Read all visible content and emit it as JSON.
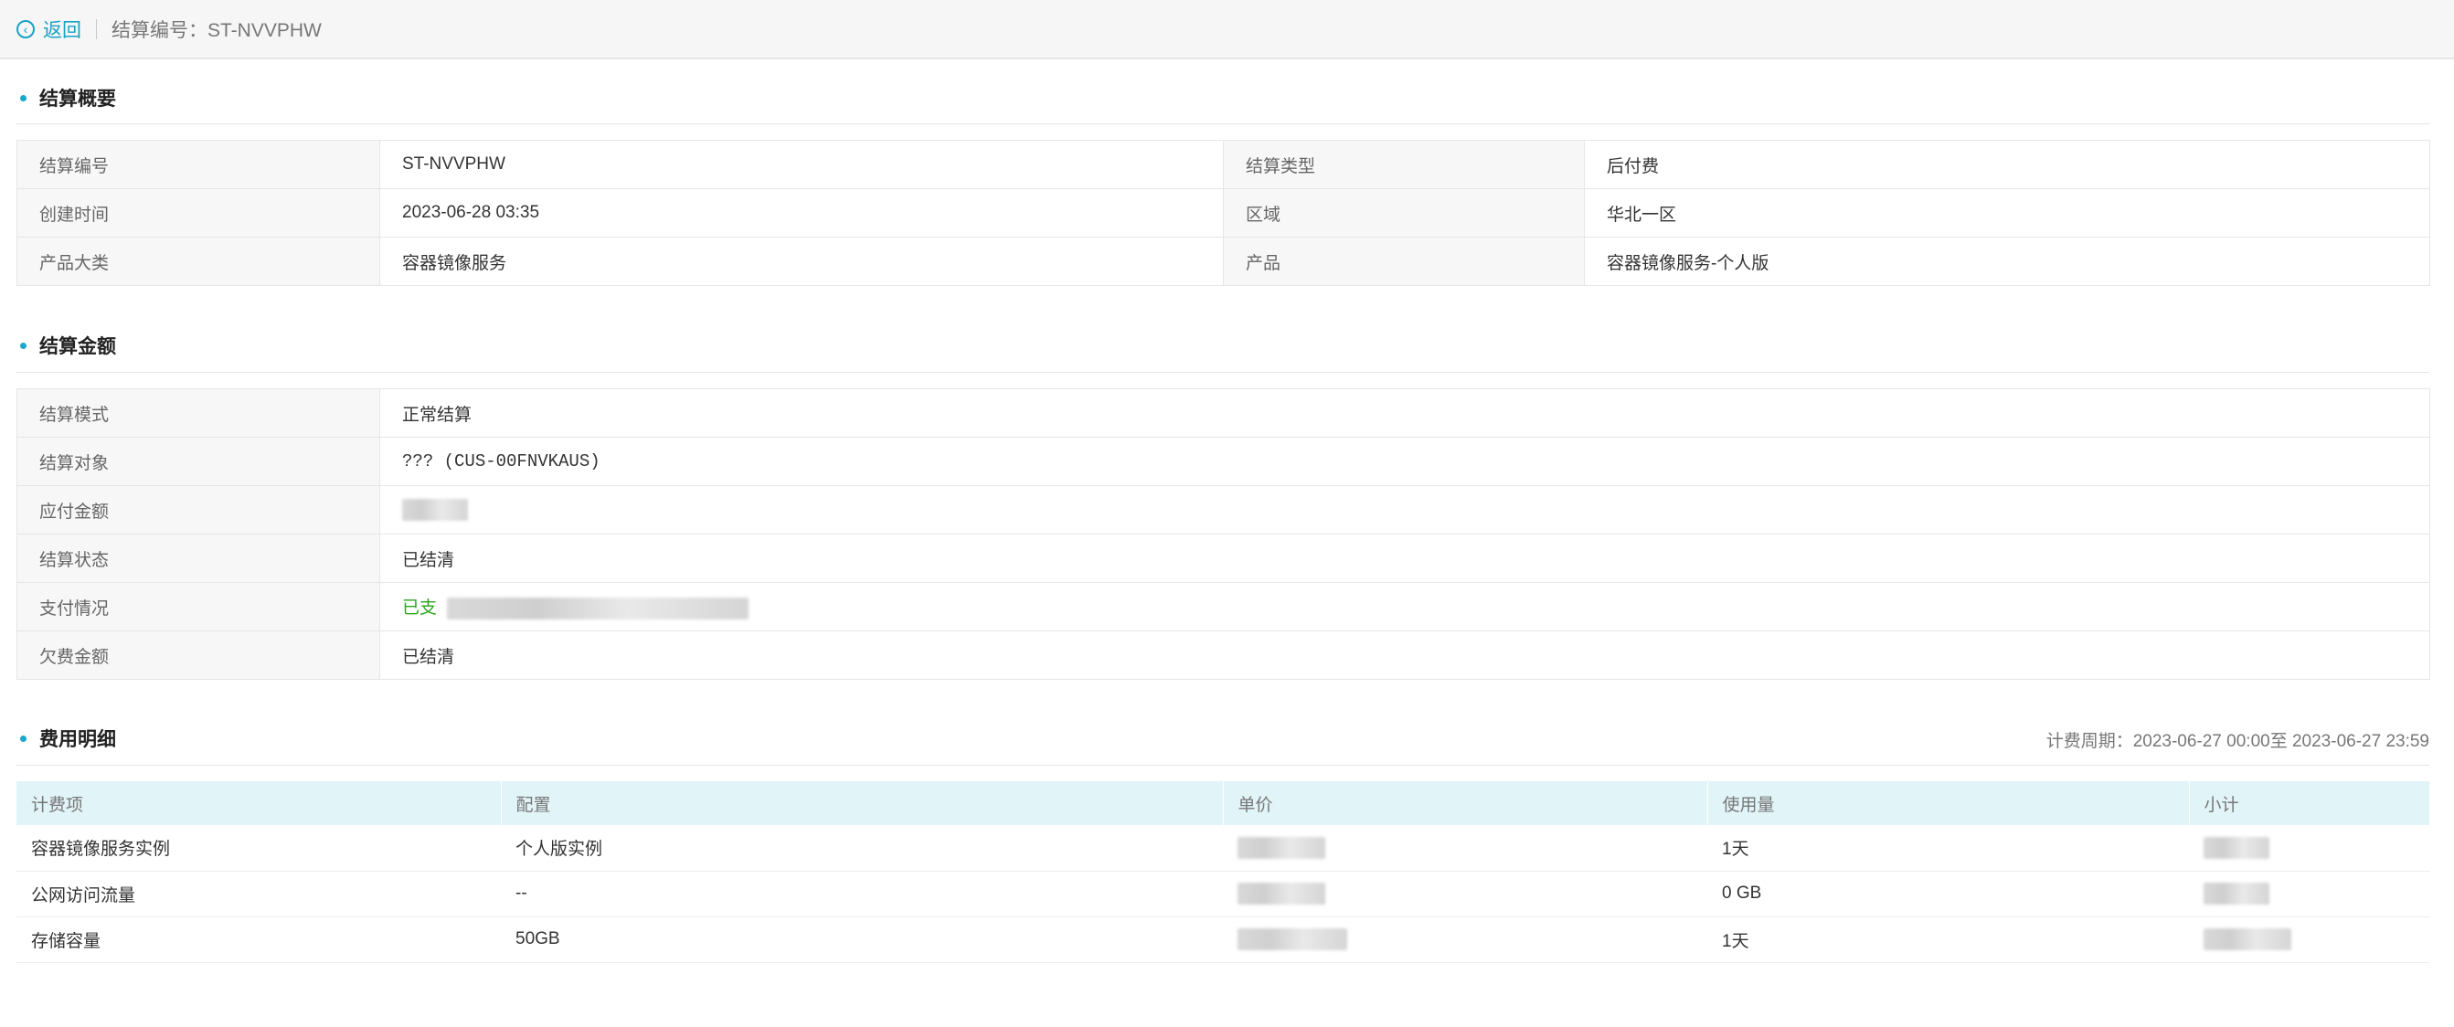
{
  "header": {
    "back_label": "返回",
    "settlement_code_label": "结算编号：ST-NVVPHW"
  },
  "overview": {
    "title": "结算概要",
    "rows": [
      {
        "k1": "结算编号",
        "v1": "ST-NVVPHW",
        "k2": "结算类型",
        "v2": "后付费"
      },
      {
        "k1": "创建时间",
        "v1": "2023-06-28 03:35",
        "k2": "区域",
        "v2": "华北一区"
      },
      {
        "k1": "产品大类",
        "v1": "容器镜像服务",
        "k2": "产品",
        "v2": "容器镜像服务-个人版"
      }
    ]
  },
  "amount": {
    "title": "结算金额",
    "rows": [
      {
        "k": "结算模式",
        "v": "正常结算"
      },
      {
        "k": "结算对象",
        "v": "??? (CUS-00FNVKAUS)"
      },
      {
        "k": "应付金额",
        "v": ""
      },
      {
        "k": "结算状态",
        "v": "已结清"
      },
      {
        "k": "支付情况",
        "v": "已支"
      },
      {
        "k": "欠费金额",
        "v": "已结清"
      }
    ]
  },
  "details": {
    "title": "费用明细",
    "period": "计费周期：2023-06-27 00:00至 2023-06-27 23:59",
    "columns": [
      "计费项",
      "配置",
      "单价",
      "使用量",
      "小计"
    ],
    "rows": [
      {
        "item": "容器镜像服务实例",
        "config": "个人版实例",
        "usage": "1天"
      },
      {
        "item": "公网访问流量",
        "config": "--",
        "usage": "0 GB"
      },
      {
        "item": "存储容量",
        "config": "50GB",
        "usage": "1天"
      }
    ]
  },
  "colors": {
    "accent": "#17a2c4",
    "success": "#2aa51d",
    "table_header": "#e1f4f8"
  }
}
